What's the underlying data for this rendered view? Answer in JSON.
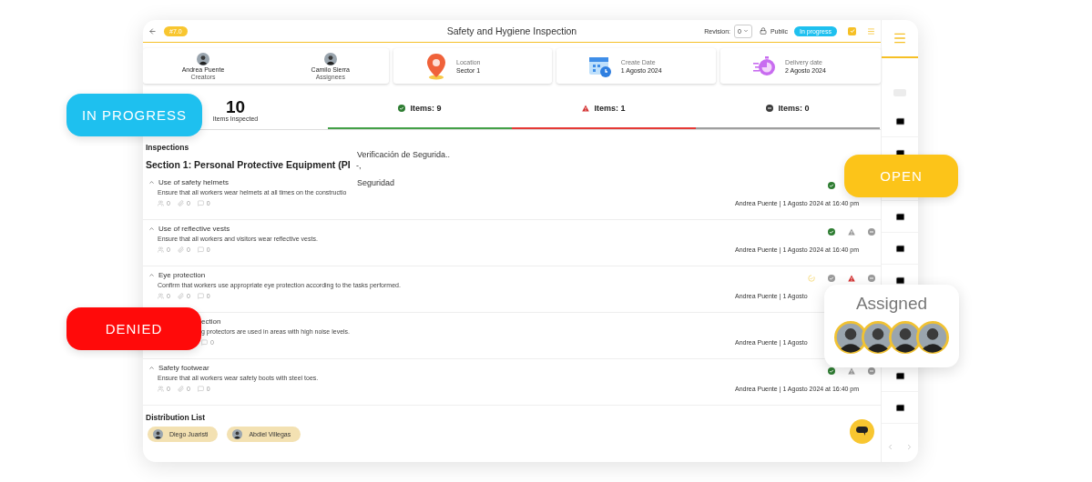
{
  "header": {
    "badge": "#7.0",
    "title": "Safety and Hygiene Inspection",
    "revision_label": "Revision:",
    "revision_value": "0",
    "visibility": "Public",
    "status": "In progress"
  },
  "people": [
    {
      "name": "Andrea Puente",
      "role": "Creators"
    },
    {
      "name": "Camilo Sierra",
      "role": "Assignees"
    }
  ],
  "info_cards": [
    {
      "kind": "location",
      "label": "Location",
      "value": "Sector 1"
    },
    {
      "kind": "create",
      "label": "Create Date",
      "value": "1 Agosto 2024"
    },
    {
      "kind": "delivery",
      "label": "Delivery date",
      "value": "2 Agosto 2024"
    }
  ],
  "summary": {
    "count": "10",
    "label": "Items Inspected",
    "tabs": [
      {
        "kind": "ok",
        "label": "Items: 9"
      },
      {
        "kind": "warning",
        "label": "Items: 1"
      },
      {
        "kind": "na",
        "label": "Items: 0"
      }
    ]
  },
  "inspections": {
    "heading": "Inspections",
    "section_title": "Section 1: Personal Protective Equipment (PI",
    "items": [
      {
        "kind": "full",
        "title": "Use of safety helmets",
        "description": "Ensure that all workers wear helmets at all times on the constructio",
        "counts": [
          {
            "kind": "people",
            "value": "0"
          },
          {
            "kind": "clip",
            "value": "0"
          },
          {
            "kind": "comment",
            "value": "0"
          }
        ],
        "statuses": [
          {
            "kind": "ok",
            "selected": true
          }
        ],
        "meta": "Andrea Puente | 1 Agosto 2024 at 16:40 pm"
      },
      {
        "kind": "full",
        "title": "Use of reflective vests",
        "description": "Ensure that all workers and visitors wear reflective vests.",
        "counts": [
          {
            "kind": "people",
            "value": "0"
          },
          {
            "kind": "clip",
            "value": "0"
          },
          {
            "kind": "comment",
            "value": "0"
          }
        ],
        "statuses": [
          {
            "kind": "ok",
            "selected": true
          },
          {
            "kind": "warning",
            "selected": false
          },
          {
            "kind": "na",
            "selected": false
          }
        ],
        "meta": "Andrea Puente | 1 Agosto 2024 at 16:40 pm"
      },
      {
        "kind": "full",
        "title": "Eye protection",
        "description": "Confirm that workers use appropriate eye protection according to the tasks performed.",
        "counts": [
          {
            "kind": "people",
            "value": "0"
          },
          {
            "kind": "clip",
            "value": "0"
          },
          {
            "kind": "comment",
            "value": "0"
          }
        ],
        "statuses": [
          {
            "kind": "pending",
            "selected": false
          },
          {
            "kind": "ok",
            "selected": false
          },
          {
            "kind": "warning",
            "selected": true
          },
          {
            "kind": "na",
            "selected": false
          }
        ],
        "meta": "Andrea Puente | 1 Agosto"
      },
      {
        "kind": "partial",
        "title": "ection",
        "description": "g protectors are used in areas with high noise levels.",
        "counts": [
          {
            "kind": "comment",
            "value": "0"
          }
        ],
        "meta": "Andrea Puente | 1 Agosto"
      },
      {
        "kind": "full",
        "title": "Safety footwear",
        "description": "Ensure that all workers wear safety boots with steel toes.",
        "counts": [
          {
            "kind": "people",
            "value": "0"
          },
          {
            "kind": "clip",
            "value": "0"
          },
          {
            "kind": "comment",
            "value": "0"
          }
        ],
        "statuses": [
          {
            "kind": "ok",
            "selected": true
          },
          {
            "kind": "warning",
            "selected": false
          },
          {
            "kind": "na",
            "selected": false
          }
        ],
        "meta": "Andrea Puente | 1 Agosto 2024 at 16:40 pm"
      }
    ]
  },
  "distribution": {
    "heading": "Distribution List",
    "people": [
      "Diego Juaristi",
      "Abdiel Villegas"
    ]
  },
  "floating_texts": [
    "Verificación de Segurida..",
    "-,",
    "Seguridad"
  ],
  "badges": [
    {
      "kind": "in_progress",
      "label": "IN PROGRESS"
    },
    {
      "kind": "open",
      "label": "OPEN"
    },
    {
      "kind": "denied",
      "label": "DENIED"
    }
  ],
  "assigned_card": {
    "title": "Assigned"
  }
}
